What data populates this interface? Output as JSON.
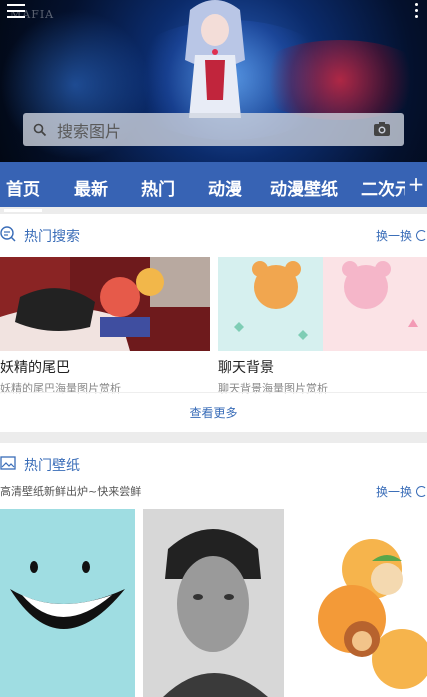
{
  "header": {
    "brand": "MAFIA",
    "search_placeholder": "搜索图片"
  },
  "tabs": [
    "首页",
    "最新",
    "热门",
    "动漫",
    "动漫壁纸",
    "二次元"
  ],
  "tab_add": "+",
  "hot_search": {
    "title": "热门搜索",
    "refresh": "换一换",
    "items": [
      {
        "name": "妖精的尾巴",
        "desc": "妖精的尾巴海量图片赏析"
      },
      {
        "name": "聊天背景",
        "desc": "聊天背景海量图片赏析"
      }
    ],
    "more": "查看更多"
  },
  "hot_wallpaper": {
    "title": "热门壁纸",
    "subtitle": "高清壁纸新鲜出炉~快来尝鲜",
    "refresh": "换一换"
  },
  "colors": {
    "accent": "#3763b4",
    "link": "#3a6db8"
  }
}
